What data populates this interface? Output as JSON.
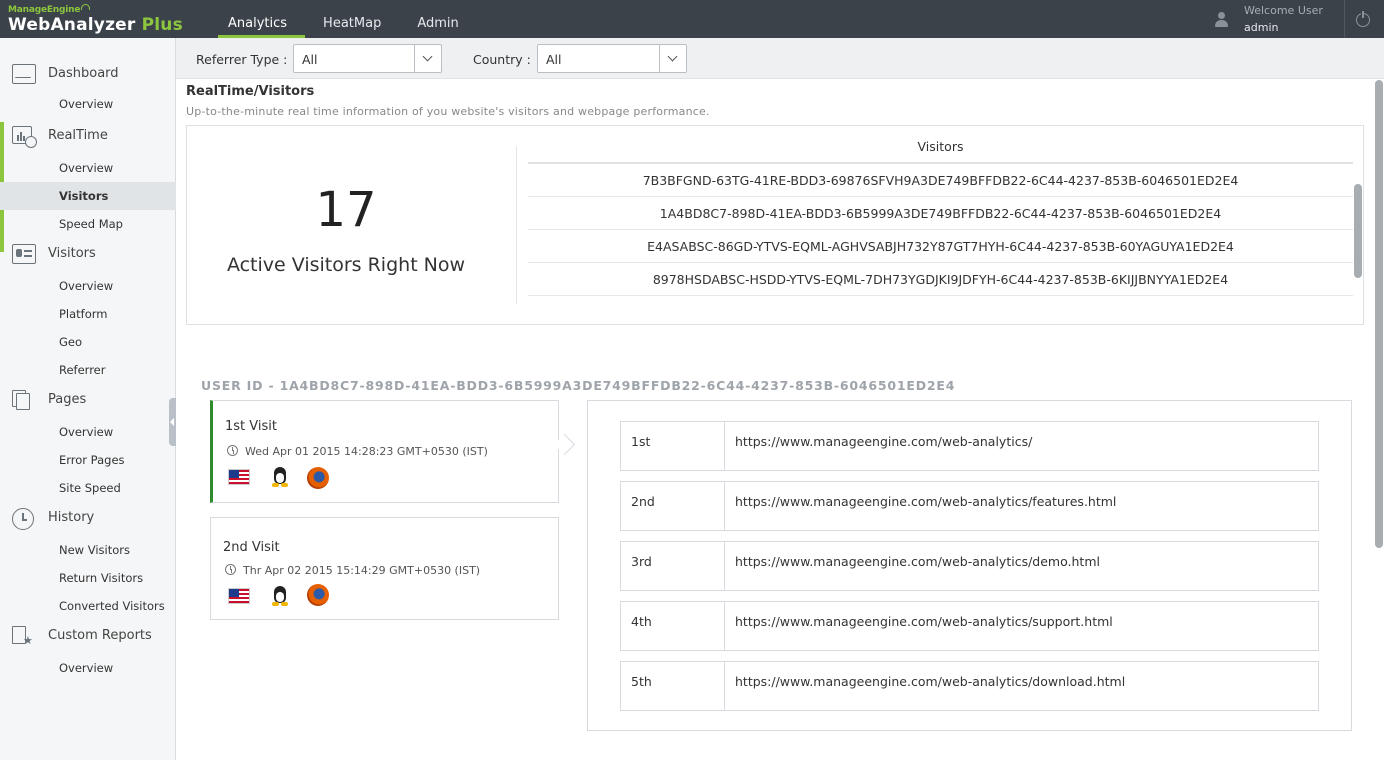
{
  "brand": {
    "company": "ManageEngine",
    "product": "WebAnalyzer",
    "edition": "Plus"
  },
  "topnav": {
    "tabs": [
      "Analytics",
      "HeatMap",
      "Admin"
    ],
    "active": "Analytics"
  },
  "user": {
    "welcome": "Welcome User",
    "name": "admin"
  },
  "sidebar": {
    "sections": [
      {
        "label": "Dashboard",
        "icon": "dashboard-icon",
        "items": [
          "Overview"
        ]
      },
      {
        "label": "RealTime",
        "icon": "realtime-icon",
        "items": [
          "Overview",
          "Visitors",
          "Speed Map"
        ]
      },
      {
        "label": "Visitors",
        "icon": "visitors-icon",
        "items": [
          "Overview",
          "Platform",
          "Geo",
          "Referrer"
        ]
      },
      {
        "label": "Pages",
        "icon": "pages-icon",
        "items": [
          "Overview",
          "Error Pages",
          "Site Speed"
        ]
      },
      {
        "label": "History",
        "icon": "history-icon",
        "items": [
          "New Visitors",
          "Return Visitors",
          "Converted Visitors"
        ]
      },
      {
        "label": "Custom Reports",
        "icon": "custom-reports-icon",
        "items": [
          "Overview"
        ]
      }
    ],
    "active_item": "RealTime/Visitors"
  },
  "filters": {
    "referrer": {
      "label": "Referrer Type :",
      "value": "All"
    },
    "country": {
      "label": "Country :",
      "value": "All"
    }
  },
  "page": {
    "title": "RealTime/Visitors",
    "subtitle": "Up-to-the-minute real time information of you website's visitors and webpage performance."
  },
  "realtime": {
    "active_count": "17",
    "active_label": "Active Visitors Right Now",
    "visitors_header": "Visitors",
    "visitors": [
      "7B3BFGND-63TG-41RE-BDD3-69876SFVH9A3DE749BFFDB22-6C44-4237-853B-6046501ED2E4",
      "1A4BD8C7-898D-41EA-BDD3-6B5999A3DE749BFFDB22-6C44-4237-853B-6046501ED2E4",
      "E4ASABSC-86GD-YTVS-EQML-AGHVSABJH732Y87GT7HYH-6C44-4237-853B-60YAGUYA1ED2E4",
      "8978HSDABSC-HSDD-YTVS-EQML-7DH73YGDJKI9JDFYH-6C44-4237-853B-6KIJJBNYYA1ED2E4"
    ]
  },
  "user_detail": {
    "user_id_label": "USER ID - 1A4BD8C7-898D-41EA-BDD3-6B5999A3DE749BFFDB22-6C44-4237-853B-6046501ED2E4",
    "visits": [
      {
        "title": "1st Visit",
        "datetime": "Wed Apr 01 2015 14:28:23 GMT+0530 (IST)",
        "icons": [
          "us-flag-icon",
          "linux-icon",
          "firefox-icon"
        ],
        "selected": true
      },
      {
        "title": "2nd Visit",
        "datetime": "Thr Apr 02 2015 15:14:29 GMT+0530 (IST)",
        "icons": [
          "us-flag-icon",
          "linux-icon",
          "firefox-icon"
        ],
        "selected": false
      }
    ],
    "pages": [
      {
        "order": "1st",
        "url": "https://www.manageengine.com/web-analytics/"
      },
      {
        "order": "2nd",
        "url": "https://www.manageengine.com/web-analytics/features.html"
      },
      {
        "order": "3rd",
        "url": "https://www.manageengine.com/web-analytics/demo.html"
      },
      {
        "order": "4th",
        "url": "https://www.manageengine.com/web-analytics/support.html"
      },
      {
        "order": "5th",
        "url": "https://www.manageengine.com/web-analytics/download.html"
      }
    ]
  },
  "colors": {
    "topbar": "#3b4249",
    "accent": "#8cc63f",
    "selected_visit": "#2e8b2e"
  }
}
